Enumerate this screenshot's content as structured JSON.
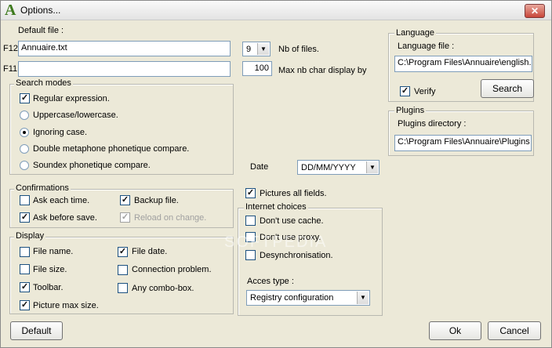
{
  "window": {
    "title": "Options...",
    "app_icon": "A",
    "close_label": "✕"
  },
  "default_file": {
    "label": "Default file :",
    "f12_label": "F12",
    "f12_value": "Annuaire.txt",
    "f11_label": "F11",
    "f11_value": ""
  },
  "nb_files": {
    "value": "9",
    "label": "Nb of files."
  },
  "max_char": {
    "value": "100",
    "label": "Max nb char display by"
  },
  "search_modes": {
    "title": "Search modes",
    "regular_expression": "Regular expression.",
    "options": [
      "Uppercase/lowercase.",
      "Ignoring case.",
      "Double metaphone phonetique compare.",
      "Soundex phonetique compare."
    ],
    "selected_index": 1
  },
  "date": {
    "label": "Date",
    "value": "DD/MM/YYYY"
  },
  "confirmations": {
    "title": "Confirmations",
    "ask_each_time": "Ask each time.",
    "ask_before_save": "Ask before save.",
    "backup_file": "Backup file.",
    "reload_on_change": "Reload on change."
  },
  "display": {
    "title": "Display",
    "file_name": "File name.",
    "file_size": "File size.",
    "toolbar": "Toolbar.",
    "picture_max_size": "Picture max size.",
    "file_date": "File date.",
    "connection_problem": "Connection problem.",
    "any_combo_box": "Any combo-box."
  },
  "pictures_all_fields": "Pictures all fields.",
  "internet_choices": {
    "title": "Internet choices",
    "dont_use_cache": "Don't use cache.",
    "dont_use_proxy": "Don't use proxy.",
    "desynchronisation": "Desynchronisation.",
    "acces_type_label": "Acces type :",
    "acces_type_value": "Registry configuration"
  },
  "language": {
    "title": "Language",
    "file_label": "Language file :",
    "file_value": "C:\\Program Files\\Annuaire\\english.lr",
    "verify": "Verify",
    "search_button": "Search"
  },
  "plugins": {
    "title": "Plugins",
    "dir_label": "Plugins directory :",
    "dir_value": "C:\\Program Files\\Annuaire\\Plugins"
  },
  "buttons": {
    "default": "Default",
    "ok": "Ok",
    "cancel": "Cancel"
  },
  "watermark": "SOFTPEDIA",
  "check_glyph": "✓",
  "colors": {
    "accent_border": "#7f9db9",
    "title_close": "#c8463a"
  }
}
